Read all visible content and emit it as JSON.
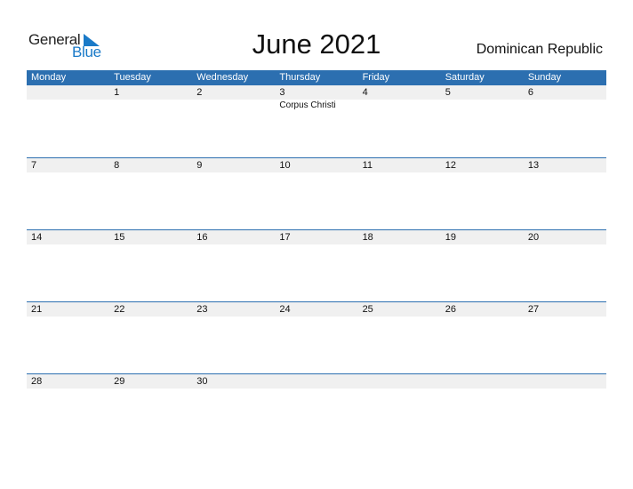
{
  "logo": {
    "general": "General",
    "blue": "Blue"
  },
  "title": "June 2021",
  "country": "Dominican Republic",
  "colors": {
    "header": "#2c6fb0",
    "strip": "#f0f0f0",
    "logo_blue": "#1a7ac8"
  },
  "weekdays": [
    "Monday",
    "Tuesday",
    "Wednesday",
    "Thursday",
    "Friday",
    "Saturday",
    "Sunday"
  ],
  "weeks": [
    {
      "days": [
        "",
        "1",
        "2",
        "3",
        "4",
        "5",
        "6"
      ],
      "events": [
        "",
        "",
        "",
        "Corpus Christi",
        "",
        "",
        ""
      ]
    },
    {
      "days": [
        "7",
        "8",
        "9",
        "10",
        "11",
        "12",
        "13"
      ],
      "events": [
        "",
        "",
        "",
        "",
        "",
        "",
        ""
      ]
    },
    {
      "days": [
        "14",
        "15",
        "16",
        "17",
        "18",
        "19",
        "20"
      ],
      "events": [
        "",
        "",
        "",
        "",
        "",
        "",
        ""
      ]
    },
    {
      "days": [
        "21",
        "22",
        "23",
        "24",
        "25",
        "26",
        "27"
      ],
      "events": [
        "",
        "",
        "",
        "",
        "",
        "",
        ""
      ]
    },
    {
      "days": [
        "28",
        "29",
        "30",
        "",
        "",
        "",
        ""
      ],
      "events": [
        "",
        "",
        "",
        "",
        "",
        "",
        ""
      ]
    }
  ]
}
